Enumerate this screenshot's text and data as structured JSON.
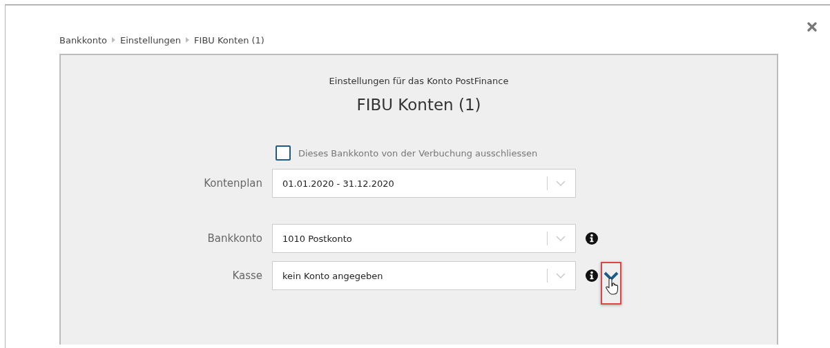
{
  "breadcrumb": [
    "Bankkonto",
    "Einstellungen",
    "FIBU Konten (1)"
  ],
  "subtitle": "Einstellungen für das Konto PostFinance",
  "title": "FIBU Konten (1)",
  "exclude_checkbox": {
    "label": "Dieses Bankkonto von der Verbuchung ausschliessen",
    "checked": false
  },
  "field_groups": [
    [
      {
        "label": "Kontenplan",
        "value": "01.01.2020 - 31.12.2020",
        "info": false,
        "expand_button": false
      }
    ],
    [
      {
        "label": "Bankkonto",
        "value": "1010 Postkonto",
        "info": true,
        "expand_button": false
      },
      {
        "label": "Kasse",
        "value": "kein Konto angegeben",
        "info": true,
        "expand_button": true
      }
    ]
  ]
}
